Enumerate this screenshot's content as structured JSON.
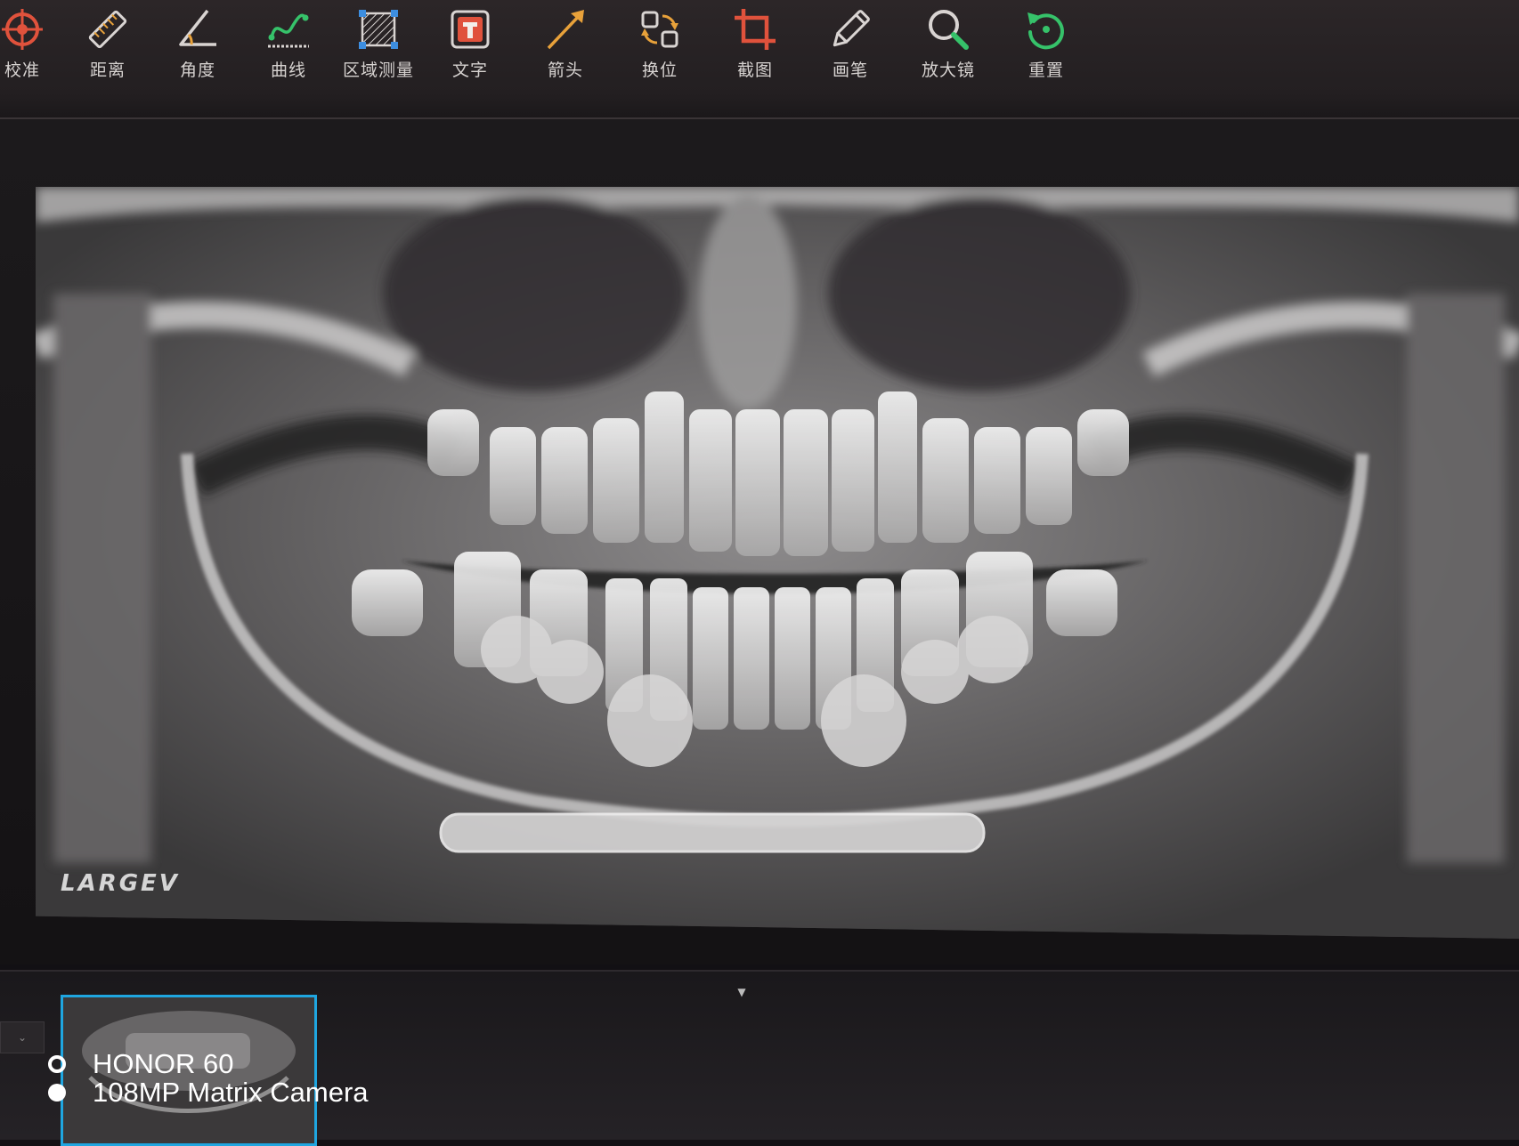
{
  "toolbar": {
    "tools": [
      {
        "label": "校准",
        "icon": "calibrate-icon"
      },
      {
        "label": "距离",
        "icon": "ruler-icon"
      },
      {
        "label": "角度",
        "icon": "angle-icon"
      },
      {
        "label": "曲线",
        "icon": "curve-icon"
      },
      {
        "label": "区域测量",
        "icon": "area-measure-icon"
      },
      {
        "label": "文字",
        "icon": "text-icon"
      },
      {
        "label": "箭头",
        "icon": "arrow-icon"
      },
      {
        "label": "换位",
        "icon": "swap-icon"
      },
      {
        "label": "截图",
        "icon": "crop-icon"
      },
      {
        "label": "画笔",
        "icon": "pencil-icon"
      },
      {
        "label": "放大镜",
        "icon": "magnifier-icon"
      },
      {
        "label": "重置",
        "icon": "reset-icon"
      }
    ]
  },
  "viewer": {
    "brand": "LARGEV"
  },
  "camera_watermark": {
    "model": "HONOR 60",
    "camera": "108MP Matrix Camera"
  },
  "colors": {
    "accent_red": "#e0523c",
    "accent_orange": "#e8a13a",
    "accent_green": "#36c26a",
    "accent_blue": "#3d8ee0",
    "thumbnail_border": "#1fa6e0"
  }
}
